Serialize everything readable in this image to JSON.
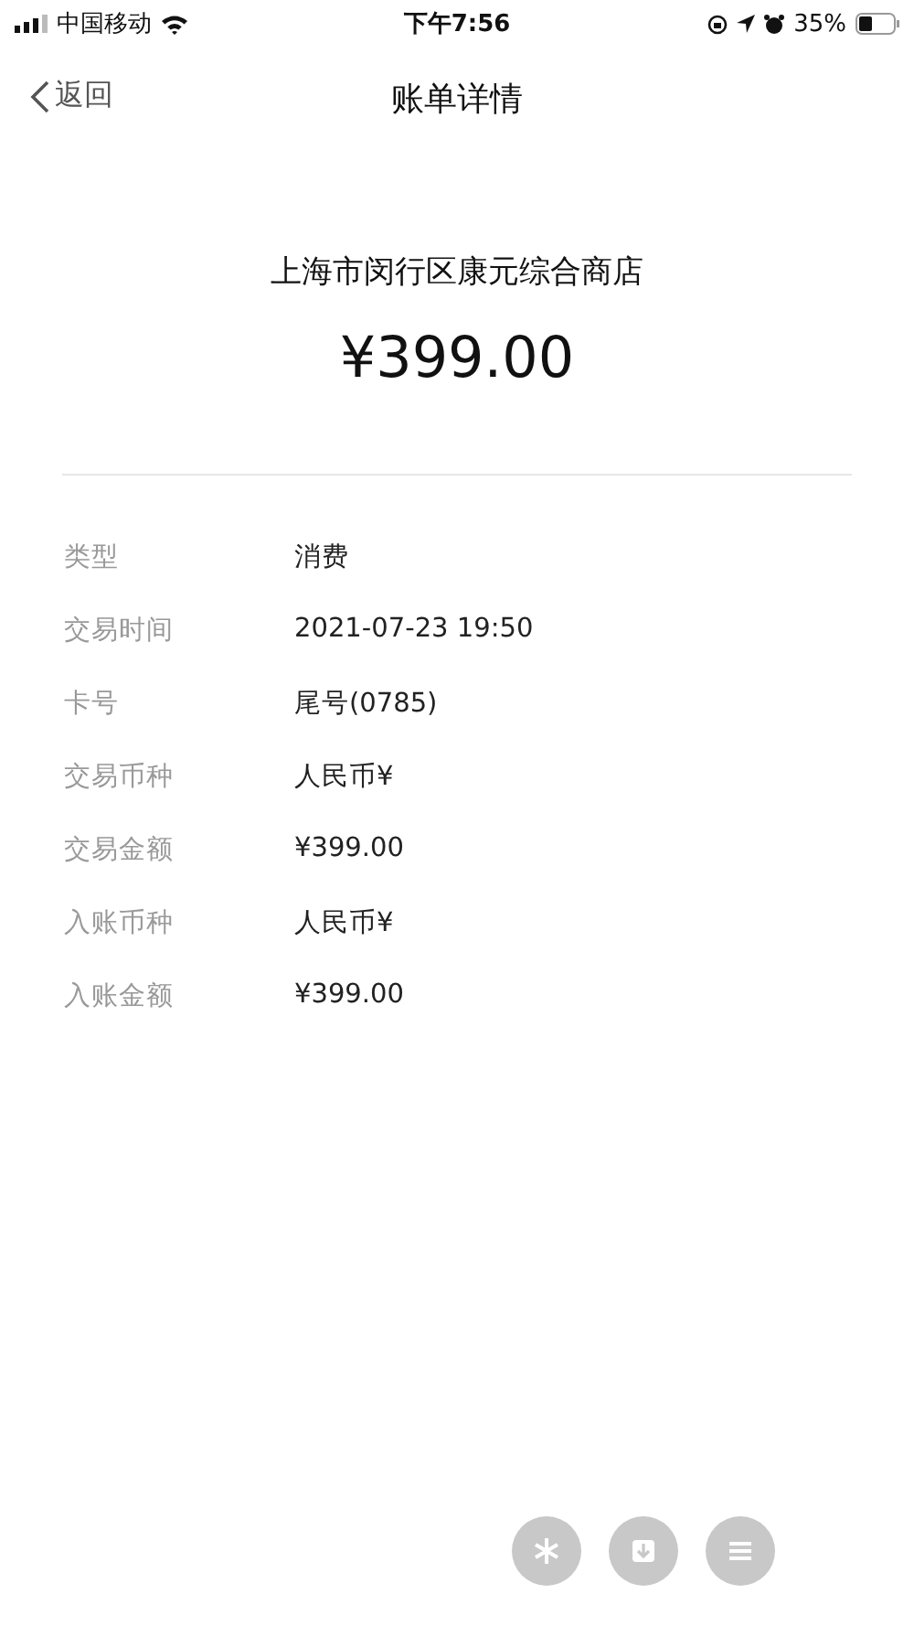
{
  "status_bar": {
    "carrier": "中国移动",
    "time": "下午7:56",
    "battery": "35%"
  },
  "nav": {
    "back": "返回",
    "title": "账单详情"
  },
  "merchant": "上海市闵行区康元综合商店",
  "amount": "¥399.00",
  "details": [
    {
      "label": "类型",
      "value": "消费"
    },
    {
      "label": "交易时间",
      "value": "2021-07-23 19:50"
    },
    {
      "label": "卡号",
      "value": "尾号(0785)"
    },
    {
      "label": "交易币种",
      "value": "人民币¥"
    },
    {
      "label": "交易金额",
      "value": "¥399.00"
    },
    {
      "label": "入账币种",
      "value": "人民币¥"
    },
    {
      "label": "入账金额",
      "value": "¥399.00"
    }
  ]
}
